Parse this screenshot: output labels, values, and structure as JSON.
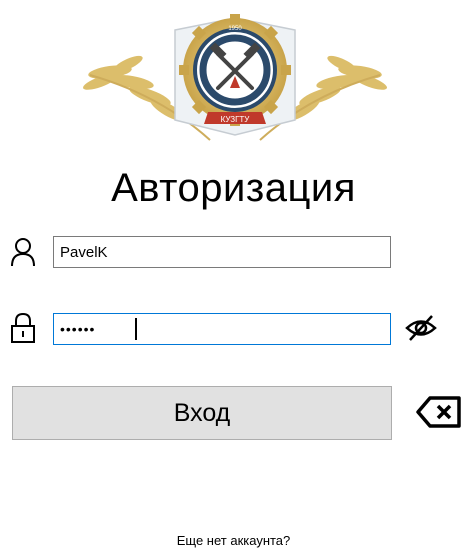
{
  "header": {
    "title": "Авторизация"
  },
  "logo": {
    "name": "kuzgtu-emblem",
    "text": "КУЗГТУ",
    "year": "1950"
  },
  "form": {
    "login": {
      "value": "PavelK",
      "icon": "user-icon"
    },
    "password": {
      "masked_value": "••••••",
      "icon": "lock-icon",
      "toggle_icon": "eye-off-icon"
    },
    "submit_label": "Вход",
    "clear_icon": "backspace-clear-icon"
  },
  "footer": {
    "register_text": "Еще нет аккаунта?"
  },
  "colors": {
    "focus_border": "#0078d7",
    "button_bg": "#e1e1e1",
    "ribbon_red": "#c0392b",
    "gold": "#c9a44a"
  }
}
